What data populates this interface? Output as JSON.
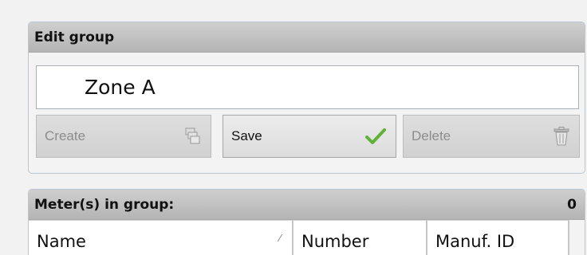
{
  "edit_group": {
    "title": "Edit group",
    "name_value": "Zone A",
    "buttons": {
      "create": {
        "label": "Create",
        "icon": "create-icon",
        "enabled": false
      },
      "save": {
        "label": "Save",
        "icon": "checkmark-icon",
        "enabled": true
      },
      "delete": {
        "label": "Delete",
        "icon": "trash-icon",
        "enabled": false
      }
    }
  },
  "meters_in_group": {
    "title": "Meter(s) in group:",
    "count": "0",
    "columns": [
      "Name",
      "Number",
      "Manuf. ID"
    ],
    "sort_indicator": "⁄"
  },
  "colors": {
    "checkmark": "#5fb33a",
    "header_bg": "#bdbdbd",
    "panel_border": "#b9c6d3"
  }
}
